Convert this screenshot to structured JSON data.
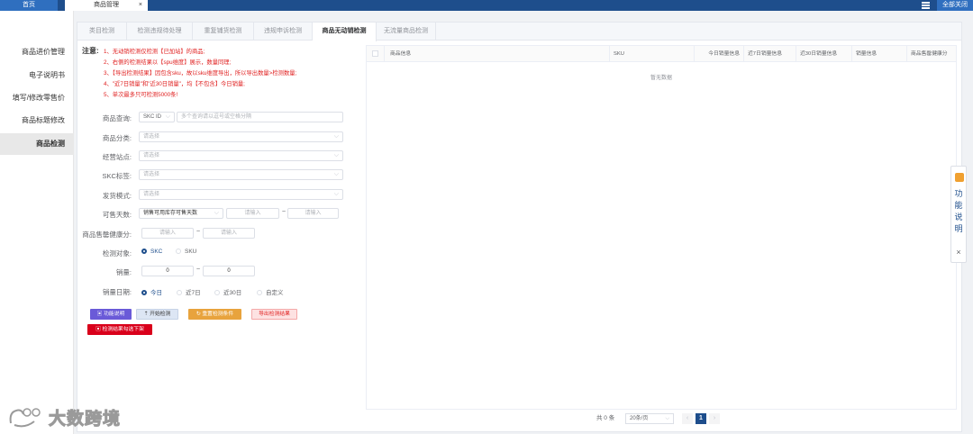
{
  "top": {
    "home": "首页",
    "active_tab": "商品管理",
    "close_all": "全部关闭",
    "close_glyph": "×"
  },
  "sidebar": {
    "items": [
      "商品进价管理",
      "电子说明书",
      "填写/修改零售价",
      "商品标题修改",
      "商品检测"
    ],
    "active_index": 4
  },
  "tabs": [
    "类目检测",
    "检测违规待处理",
    "重复铺货检测",
    "违规申诉检测",
    "商品无动销检测",
    "无流量商品检测"
  ],
  "active_tab_index": 4,
  "notes": {
    "label": "注意:",
    "items": [
      "1、无动销检测仅检测【已加站】的商品;",
      "2、右侧的检测结果以【spu维度】展示，数量同理;",
      "3、【导出检测结果】因包含sku，故以sku维度导出，所以导出数量>检测数量;",
      "4、\"近7日销量\"和\"近30日销量\"，均【不包含】今日销量;",
      "5、单次最多只可检测5000条!"
    ]
  },
  "form": {
    "query_label": "商品查询:",
    "query_type": "SKC ID",
    "query_placeholder": "多个查询请以逗号或空格分隔",
    "category_label": "商品分类:",
    "category_placeholder": "请选择",
    "site_label": "经营站点:",
    "site_placeholder": "请选择",
    "skc_tag_label": "SKC标签:",
    "skc_tag_placeholder": "请选择",
    "ship_label": "发货模式:",
    "ship_placeholder": "请选择",
    "days_label": "可售天数:",
    "days_select": "销售可用库存可售天数",
    "days_min_placeholder": "请输入",
    "days_max_placeholder": "请输入",
    "health_label": "商品售罄健康分:",
    "health_min_placeholder": "请输入",
    "health_max_placeholder": "请输入",
    "range_sep": "~",
    "target_label": "检测对象:",
    "target_options": [
      "SKC",
      "SKU"
    ],
    "target_selected": 0,
    "sales_label": "销量:",
    "sales_min": "0",
    "sales_max": "0",
    "date_label": "销量日期:",
    "date_options": [
      "今日",
      "近7日",
      "近30日",
      "自定义"
    ],
    "date_selected": 0
  },
  "buttons": {
    "help": "功能说明",
    "start": "开始检测",
    "reset": "重置检测条件",
    "export": "导出检测结果",
    "delist": "检测结果勾选下架",
    "help_glyph": "▣",
    "start_glyph": "⇡",
    "reset_glyph": "↻",
    "delist_glyph": "▣"
  },
  "table": {
    "columns": [
      "商品信息",
      "SKU",
      "今日销量信息",
      "近7日销量信息",
      "近30日销量信息",
      "销量信息",
      "商品售罄健康分"
    ],
    "empty_text": "暂无数据"
  },
  "pager": {
    "total": "共 0 条",
    "page_size": "20条/页",
    "current_page": "1",
    "prev": "‹",
    "next": "›"
  },
  "help_panel": {
    "text": "功能说明",
    "close": "×"
  },
  "watermark": {
    "text": "大数跨境"
  },
  "colors": {
    "brand": "#1e4e8c",
    "warning": "#e02020",
    "accent_purple": "#6a5ad8",
    "accent_orange": "#e8a33d"
  }
}
